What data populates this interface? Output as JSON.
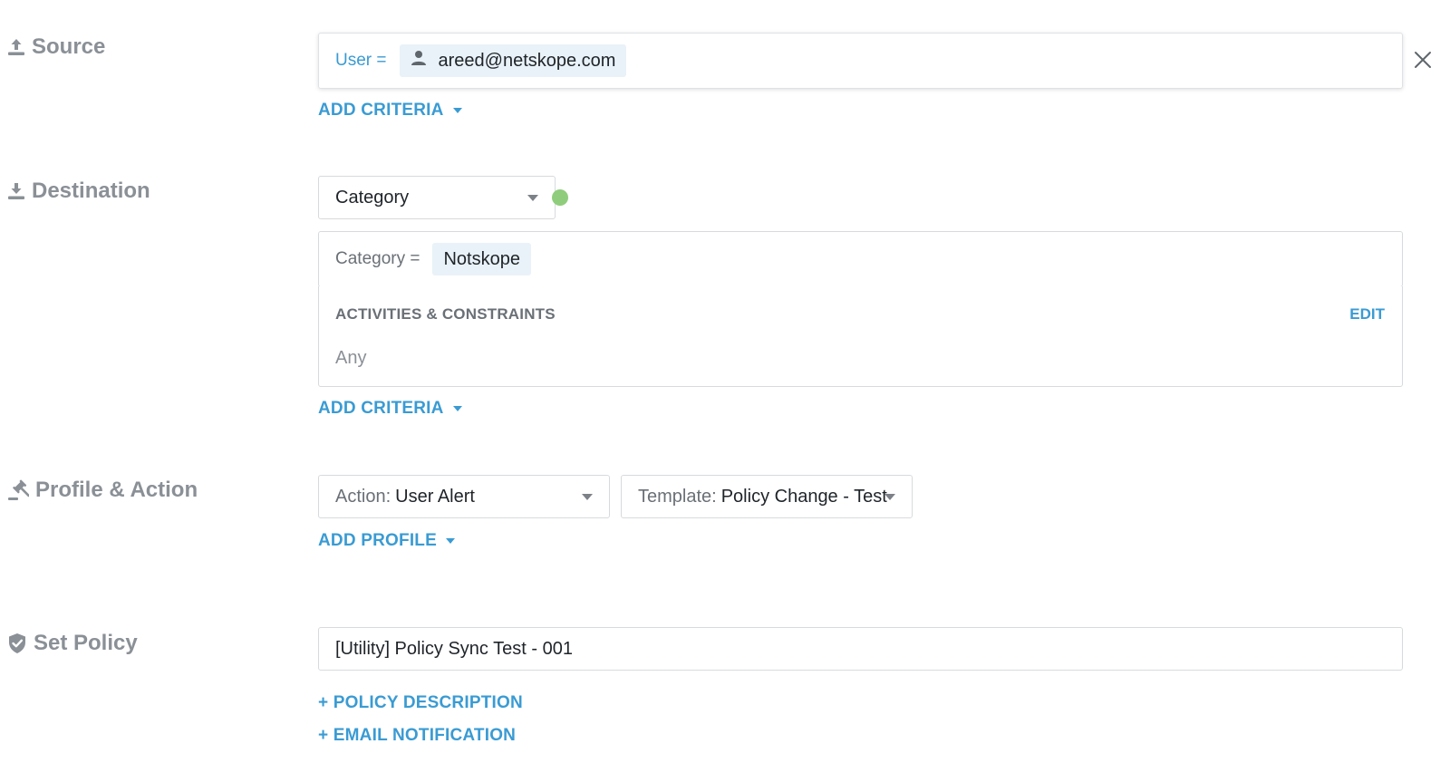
{
  "sections": {
    "source": {
      "label": "Source",
      "icon": "upload-icon",
      "criteria_key": "User =",
      "chip_icon": "user-icon",
      "chip_value": "areed@netskope.com",
      "add_criteria": "ADD CRITERIA"
    },
    "destination": {
      "label": "Destination",
      "icon": "download-icon",
      "type_select": "Category",
      "status_color": "#8fcd7c",
      "criteria_key": "Category =",
      "chip_value": "Notskope",
      "activities_title": "ACTIVITIES & CONSTRAINTS",
      "activities_edit": "EDIT",
      "activities_value": "Any",
      "add_criteria": "ADD CRITERIA"
    },
    "profile_action": {
      "label": "Profile & Action",
      "icon": "gavel-icon",
      "action_prefix": "Action:",
      "action_value": "User Alert",
      "template_prefix": "Template:",
      "template_value": "Policy Change - Test",
      "add_profile": "ADD PROFILE"
    },
    "set_policy": {
      "label": "Set Policy",
      "icon": "shield-check-icon",
      "policy_name": "[Utility] Policy Sync Test - 001",
      "policy_description_link": "+ POLICY DESCRIPTION",
      "email_notification_link": "+ EMAIL NOTIFICATION"
    }
  },
  "colors": {
    "accent": "#3a9bd3",
    "label_grey": "#8a9096",
    "chip_bg": "#e9f2f8"
  }
}
